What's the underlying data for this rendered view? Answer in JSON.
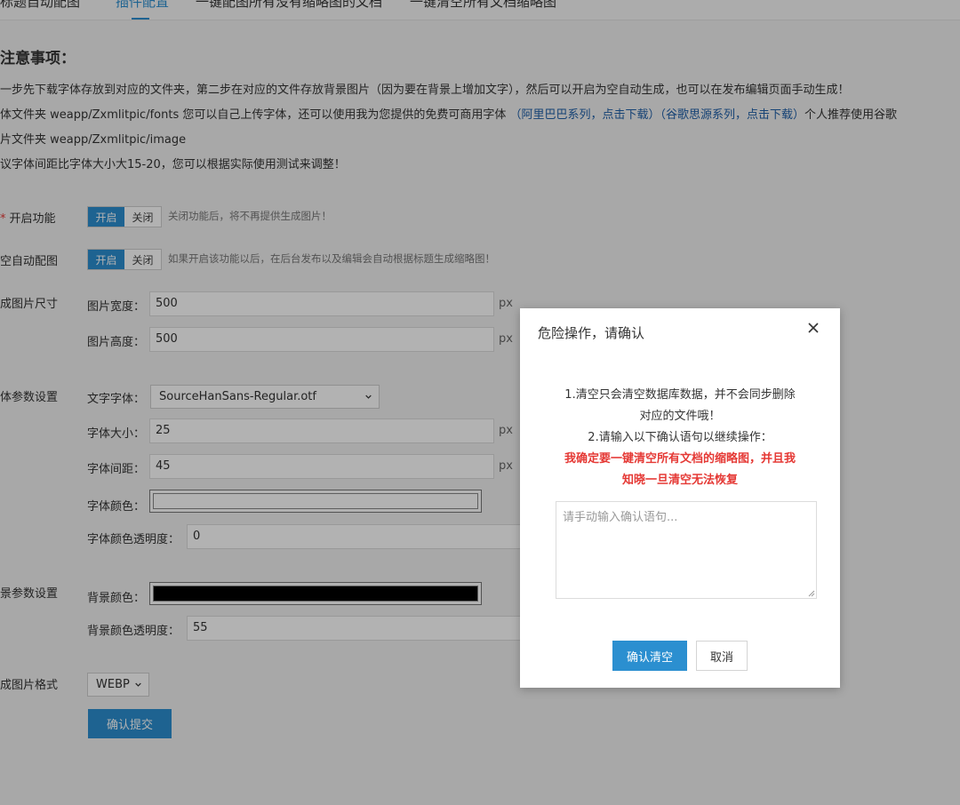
{
  "nav": {
    "tabs": [
      {
        "label": "标题自动配图"
      },
      {
        "label": "插件配置"
      },
      {
        "label": "一键配图所有没有缩略图的文档"
      },
      {
        "label": "一键清空所有文档缩略图"
      }
    ]
  },
  "notice": {
    "title": "注意事项：",
    "line1": "一步先下载字体存放到对应的文件夹，第二步在对应的文件存放背景图片（因为要在背景上增加文字），然后可以开启为空自动生成，也可以在发布编辑页面手动生成！",
    "line2_prefix": "体文件夹 weapp/Zxmlitpic/fonts 您可以自己上传字体，还可以使用我为您提供的免费可商用字体 ",
    "line2_link1": "（阿里巴巴系列，点击下载）",
    "line2_link2": "（谷歌思源系列，点击下载）",
    "line2_suffix": "个人推荐使用谷歌",
    "line3": "片文件夹 weapp/Zxmlitpic/image",
    "line4": "议字体间距比字体大小大15-20，您可以根据实际使用测试来调整！"
  },
  "settings": {
    "enable": {
      "label": "开启功能",
      "on": "开启",
      "off": "关闭",
      "hint": "关闭功能后，将不再提供生成图片！"
    },
    "auto": {
      "label": "空自动配图",
      "on": "开启",
      "off": "关闭",
      "hint": "如果开启该功能以后，在后台发布以及编辑会自动根据标题生成缩略图！"
    },
    "size": {
      "label": "成图片尺寸",
      "width_label": "图片宽度：",
      "width_value": "500",
      "height_label": "图片高度：",
      "height_value": "500",
      "unit": "px"
    },
    "font": {
      "label": "体参数设置",
      "family_label": "文字字体：",
      "family_value": "SourceHanSans-Regular.otf",
      "size_label": "字体大小：",
      "size_value": "25",
      "spacing_label": "字体间距：",
      "spacing_value": "45",
      "color_label": "字体颜色：",
      "color_value": "#ffffff",
      "opacity_label": "字体颜色透明度：",
      "opacity_value": "0",
      "unit": "px"
    },
    "background": {
      "label": "景参数设置",
      "color_label": "背景颜色：",
      "color_value": "#000000",
      "opacity_label": "背景颜色透明度：",
      "opacity_value": "55"
    },
    "format": {
      "label": "成图片格式",
      "value": "WEBP"
    },
    "submit_label": "确认提交"
  },
  "modal": {
    "title": "危险操作，请确认",
    "line1": "1.清空只会清空数据库数据，并不会同步删除",
    "line2": "对应的文件哦！",
    "line3": "2.请输入以下确认语句以继续操作：",
    "warn1": "我确定要一键清空所有文档的缩略图，并且我",
    "warn2": "知晓一旦清空无法恢复",
    "textarea_placeholder": "请手动输入确认语句...",
    "confirm_label": "确认清空",
    "cancel_label": "取消"
  },
  "colors": {
    "accent": "#2b8fd0",
    "danger": "#e53935",
    "link": "#1f5fa8"
  }
}
